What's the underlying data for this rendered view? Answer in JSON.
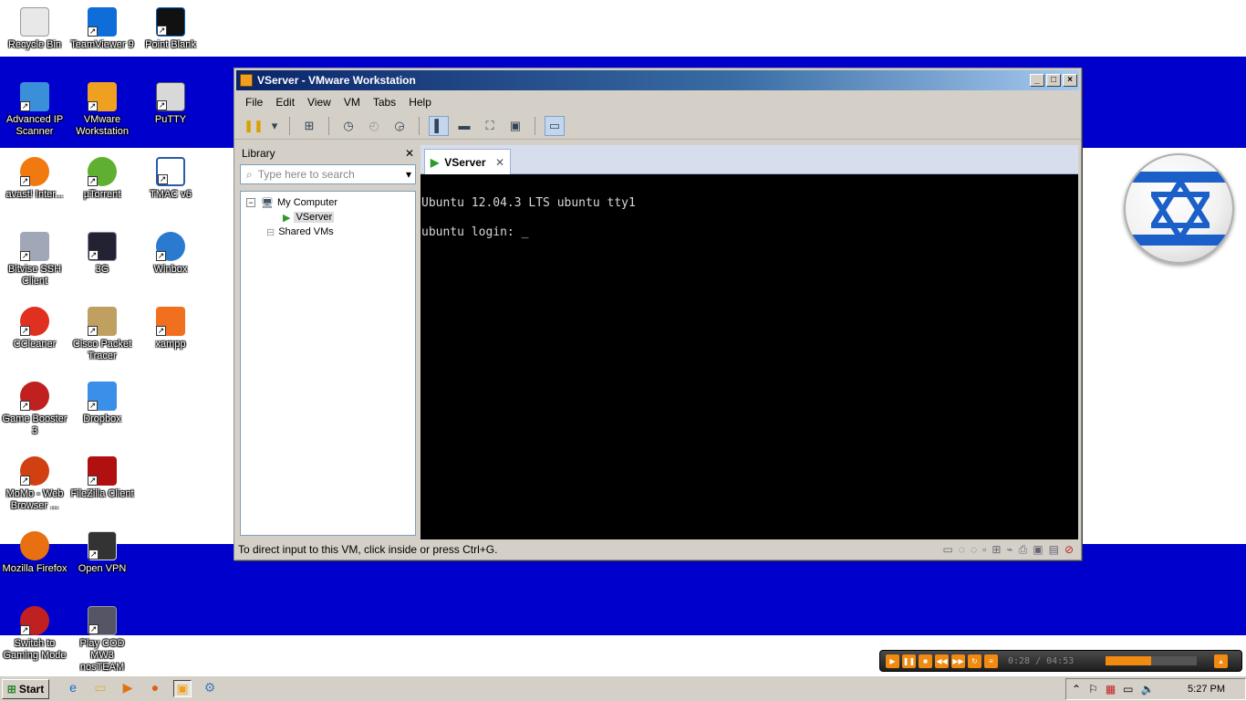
{
  "desktop": {
    "icons": [
      {
        "label": "Recycle Bin"
      },
      {
        "label": "TeamViewer 9"
      },
      {
        "label": "Point Blank"
      },
      {
        "label": "Advanced IP Scanner"
      },
      {
        "label": "VMware Workstation"
      },
      {
        "label": "PuTTY"
      },
      {
        "label": "avast! Inter..."
      },
      {
        "label": "µTorrent"
      },
      {
        "label": "TMAC v6"
      },
      {
        "label": "Bitvise SSH Client"
      },
      {
        "label": "3G"
      },
      {
        "label": "Winbox"
      },
      {
        "label": "CCleaner"
      },
      {
        "label": "Cisco Packet Tracer"
      },
      {
        "label": "xampp"
      },
      {
        "label": "Game Booster 3"
      },
      {
        "label": "Dropbox"
      },
      {
        "label": "MoMo - Web Browser ..."
      },
      {
        "label": "FileZilla Client"
      },
      {
        "label": "Mozilla Firefox"
      },
      {
        "label": "Open VPN"
      },
      {
        "label": "Switch to Gaming Mode"
      },
      {
        "label": "Play COD MW3 nosTEAM"
      }
    ]
  },
  "window": {
    "title": "VServer - VMware Workstation",
    "menu": [
      "File",
      "Edit",
      "View",
      "VM",
      "Tabs",
      "Help"
    ],
    "library": {
      "title": "Library",
      "search_placeholder": "Type here to search",
      "tree": {
        "my_computer": "My Computer",
        "vm": "VServer",
        "shared": "Shared VMs"
      }
    },
    "tab": {
      "label": "VServer"
    },
    "console": {
      "line1": "Ubuntu 12.04.3 LTS ubuntu tty1",
      "line2": "ubuntu login: _"
    },
    "status": "To direct input to this VM, click inside or press Ctrl+G."
  },
  "player": {
    "time": "0:28 / 04:53"
  },
  "taskbar": {
    "start": "Start",
    "clock": "5:27 PM"
  },
  "colors": {
    "stripe": "#0000cc",
    "title_grad_start": "#0a246a",
    "accent": "#f08a10"
  }
}
